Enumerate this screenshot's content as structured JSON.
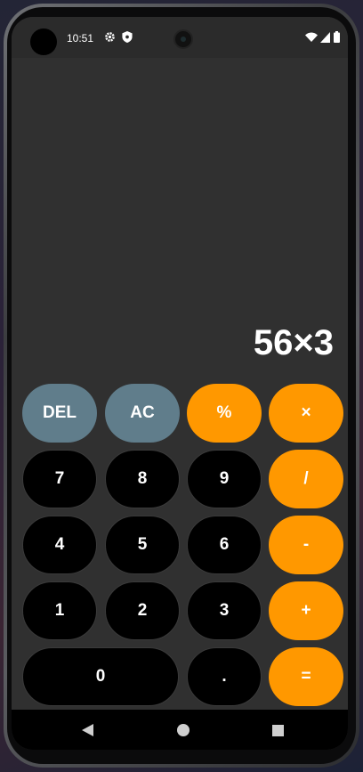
{
  "status_bar": {
    "time": "10:51",
    "left_icons": [
      "gear-icon",
      "shield-icon"
    ],
    "right_icons": [
      "wifi-icon",
      "signal-icon",
      "battery-icon"
    ]
  },
  "display": {
    "expression": "56×3"
  },
  "keys": {
    "del": "DEL",
    "ac": "AC",
    "percent": "%",
    "multiply": "×",
    "seven": "7",
    "eight": "8",
    "nine": "9",
    "divide": "/",
    "four": "4",
    "five": "5",
    "six": "6",
    "minus": "-",
    "one": "1",
    "two": "2",
    "three": "3",
    "plus": "+",
    "zero": "0",
    "decimal": ".",
    "equals": "="
  },
  "colors": {
    "operator": "#ff9800",
    "function": "#607d8b",
    "number": "#000000",
    "background": "#303030"
  },
  "nav_bar": {
    "icons": [
      "back-icon",
      "home-icon",
      "recents-icon"
    ]
  }
}
